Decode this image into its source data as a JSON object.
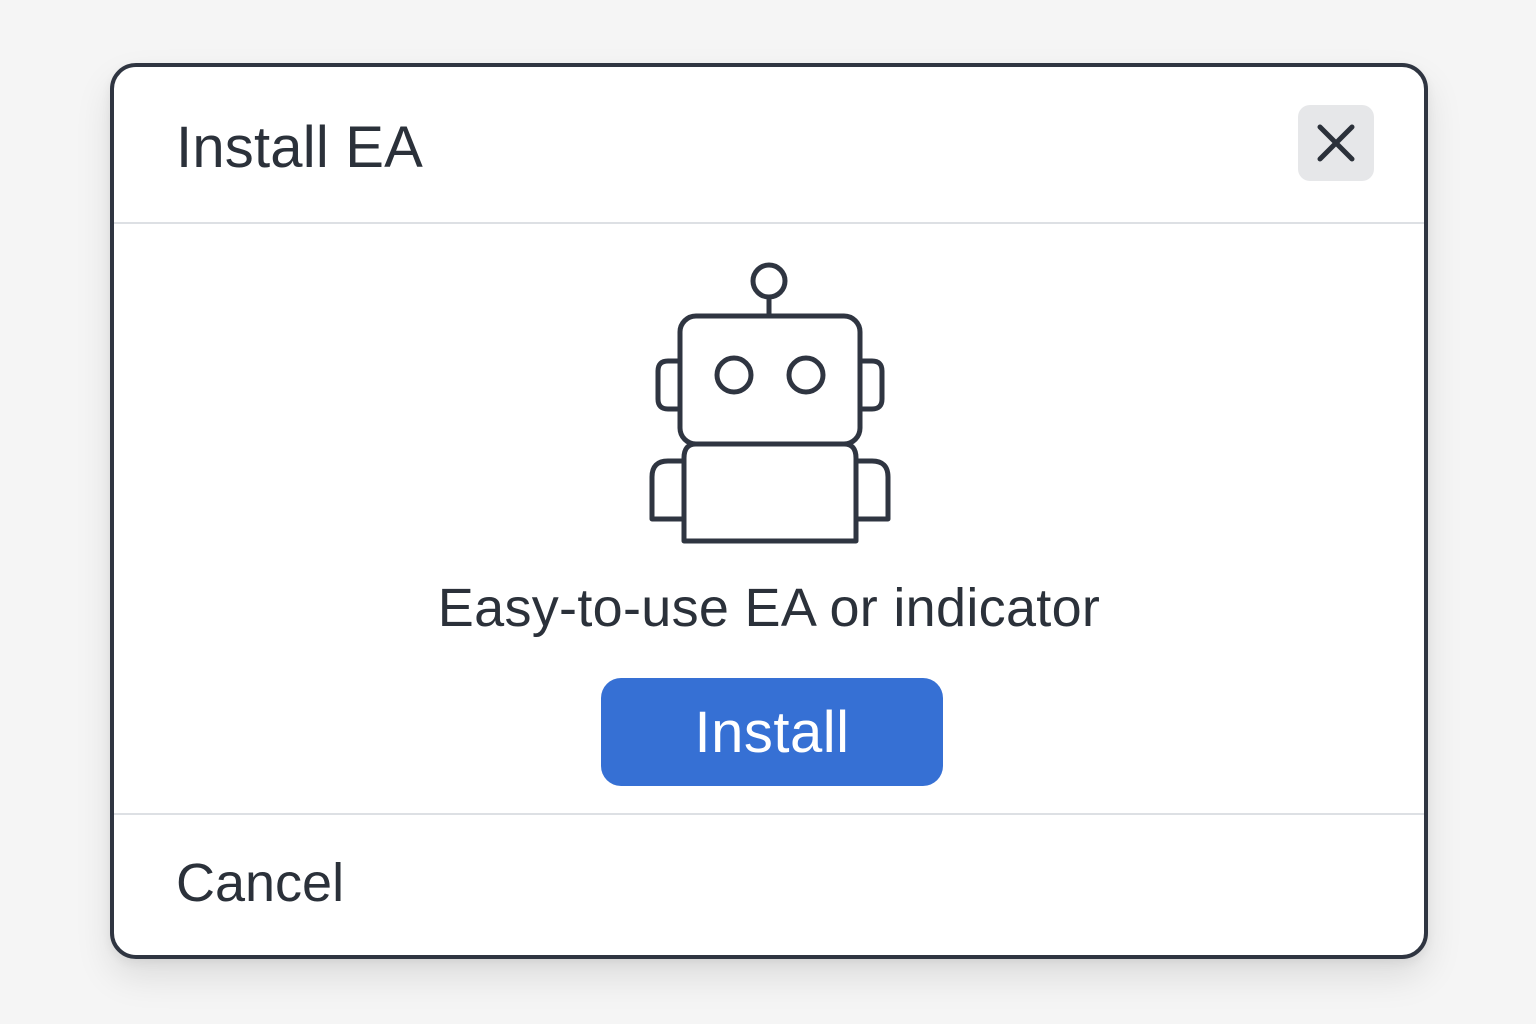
{
  "dialog": {
    "title": "Install EA",
    "close_icon": "close-icon",
    "illustration_icon": "robot-icon",
    "description": "Easy-to-use EA or indicator",
    "install_label": "Install",
    "cancel_label": "Cancel"
  },
  "colors": {
    "background": "#f5f5f5",
    "dialog_background": "#ffffff",
    "border": "#2f3541",
    "text": "#2b313a",
    "divider": "#dde0e4",
    "close_button_background": "#e6e7e9",
    "accent": "#3670d4"
  }
}
